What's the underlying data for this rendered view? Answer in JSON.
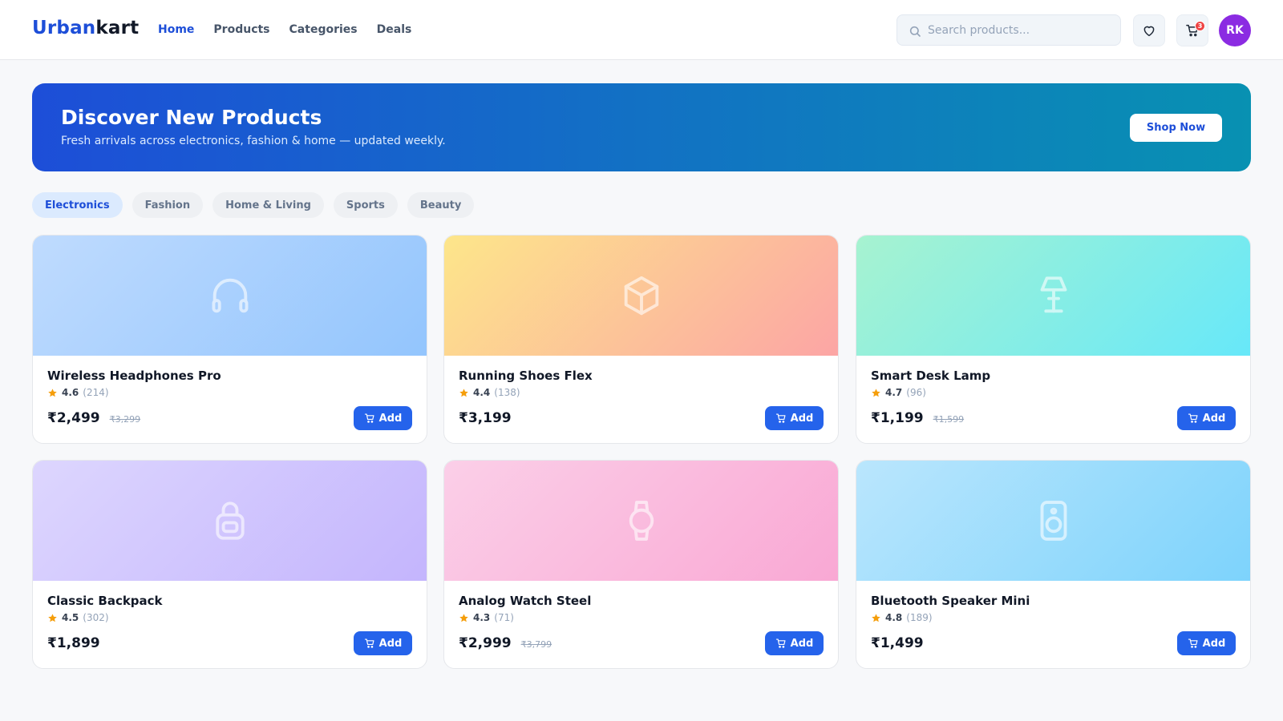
{
  "header": {
    "logo_primary": "Urban",
    "logo_secondary": "kart",
    "nav": [
      {
        "label": "Home",
        "active": true
      },
      {
        "label": "Products",
        "active": false
      },
      {
        "label": "Categories",
        "active": false
      },
      {
        "label": "Deals",
        "active": false
      }
    ],
    "search_placeholder": "Search products...",
    "cart_count": "3",
    "avatar_initials": "RK"
  },
  "banner": {
    "title": "Discover New Products",
    "subtitle": "Fresh arrivals across electronics, fashion & home — updated weekly.",
    "cta_label": "Shop Now"
  },
  "categories": [
    {
      "label": "Electronics",
      "active": true
    },
    {
      "label": "Fashion",
      "active": false
    },
    {
      "label": "Home & Living",
      "active": false
    },
    {
      "label": "Sports",
      "active": false
    },
    {
      "label": "Beauty",
      "active": false
    }
  ],
  "products": [
    {
      "name": "Wireless Headphones Pro",
      "rating": "4.6",
      "reviews": "(214)",
      "price": "₹2,499",
      "old_price": "₹3,299",
      "icon": "headphones-icon",
      "add_label": "Add"
    },
    {
      "name": "Running Shoes Flex",
      "rating": "4.4",
      "reviews": "(138)",
      "price": "₹3,199",
      "old_price": "",
      "icon": "box-icon",
      "add_label": "Add"
    },
    {
      "name": "Smart Desk Lamp",
      "rating": "4.7",
      "reviews": "(96)",
      "price": "₹1,199",
      "old_price": "₹1,599",
      "icon": "lamp-icon",
      "add_label": "Add"
    },
    {
      "name": "Classic Backpack",
      "rating": "4.5",
      "reviews": "(302)",
      "price": "₹1,899",
      "old_price": "",
      "icon": "backpack-icon",
      "add_label": "Add"
    },
    {
      "name": "Analog Watch Steel",
      "rating": "4.3",
      "reviews": "(71)",
      "price": "₹2,999",
      "old_price": "₹3,799",
      "icon": "watch-icon",
      "add_label": "Add"
    },
    {
      "name": "Bluetooth Speaker Mini",
      "rating": "4.8",
      "reviews": "(189)",
      "price": "₹1,499",
      "old_price": "",
      "icon": "speaker-icon",
      "add_label": "Add"
    }
  ],
  "colors": {
    "accent": "#2563eb",
    "brand": "#1d4ed8",
    "avatar": "#8b2be2",
    "badge": "#ef4444",
    "star": "#f59e0b"
  }
}
